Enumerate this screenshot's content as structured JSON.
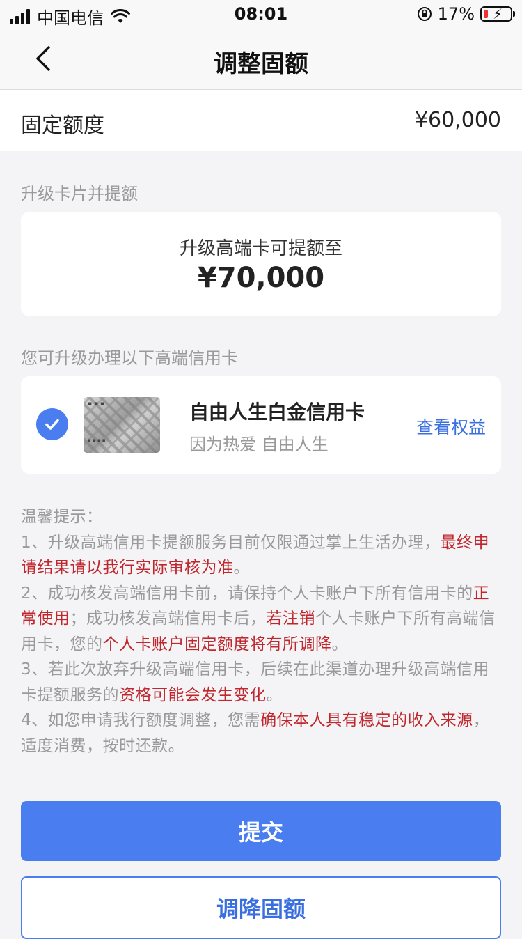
{
  "status_bar": {
    "carrier": "中国电信",
    "time": "08:01",
    "battery_percent": "17%",
    "icons": [
      "signal-icon",
      "wifi-icon",
      "orientation-lock-icon",
      "battery-charging-icon"
    ]
  },
  "nav": {
    "title": "调整固额",
    "back_icon": "chevron-left-icon"
  },
  "fixed_limit": {
    "label": "固定额度",
    "value": "¥60,000"
  },
  "upgrade_section": {
    "title": "升级卡片并提额",
    "card_subtitle": "升级高端卡可提额至",
    "card_amount": "¥70,000"
  },
  "card_list": {
    "title": "您可升级办理以下高端信用卡",
    "items": [
      {
        "name": "自由人生白金信用卡",
        "slogan": "因为热爱 自由人生",
        "link": "查看权益",
        "selected": true
      }
    ]
  },
  "tips": {
    "title": "温馨提示：",
    "item1_a": "1、升级高端信用卡提额服务目前仅限通过掌上生活办理，",
    "item1_b": "最终申请结果请以我行实际审核为准",
    "item1_c": "。",
    "item2_a": "2、成功核发高端信用卡前，请保持个人卡账户下所有信用卡的",
    "item2_b": "正常使用",
    "item2_c": "；成功核发高端信用卡后，",
    "item2_d": "若注销",
    "item2_e": "个人卡账户下所有高端信用卡，您的",
    "item2_f": "个人卡账户固定额度将有所调降",
    "item2_g": "。",
    "item3_a": "3、若此次放弃升级高端信用卡，后续在此渠道办理升级高端信用卡提额服务的",
    "item3_b": "资格可能会发生变化",
    "item3_c": "。",
    "item4_a": "4、如您申请我行额度调整，您需",
    "item4_b": "确保本人具有稳定的收入来源",
    "item4_c": "，适度消费，按时还款。"
  },
  "buttons": {
    "submit": "提交",
    "decrease": "调降固额"
  },
  "colors": {
    "primary": "#4a7ef0",
    "link": "#3a6fe0",
    "warning_red": "#c0272d",
    "muted": "#9a9a9a",
    "background": "#f4f4f6"
  }
}
